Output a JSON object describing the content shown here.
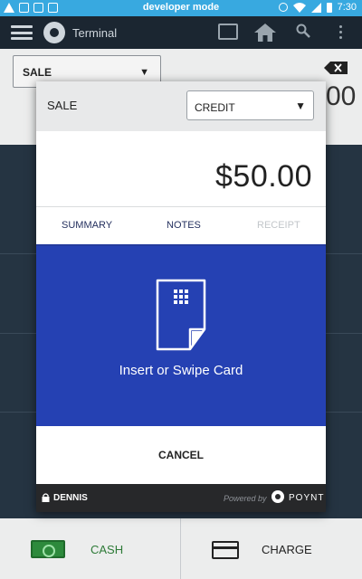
{
  "status_bar": {
    "title": "developer mode",
    "time": "7:30"
  },
  "app_bar": {
    "title": "Terminal",
    "icons": [
      "menu-icon",
      "poynt-logo-icon",
      "window-icon",
      "home-icon",
      "search-icon",
      "more-vert-icon"
    ]
  },
  "background": {
    "transaction_type": "SALE",
    "amount_fragment": "00",
    "cash_label": "CASH",
    "charge_label": "CHARGE"
  },
  "modal": {
    "title": "SALE",
    "payment_method": "CREDIT",
    "amount": "$50.00",
    "tabs": [
      {
        "label": "SUMMARY",
        "enabled": true
      },
      {
        "label": "NOTES",
        "enabled": true
      },
      {
        "label": "RECEIPT",
        "enabled": false
      }
    ],
    "prompt": "Insert or Swipe Card",
    "cancel_label": "CANCEL",
    "footer": {
      "user": "DENNIS",
      "powered_by": "Powered by",
      "brand": "POYNT"
    }
  },
  "colors": {
    "status_bar": "#38a9e0",
    "card_area": "#2541b3",
    "tab_text": "#25315f",
    "tab_disabled": "#c2c6ca",
    "cash_green": "#2d7a37"
  }
}
